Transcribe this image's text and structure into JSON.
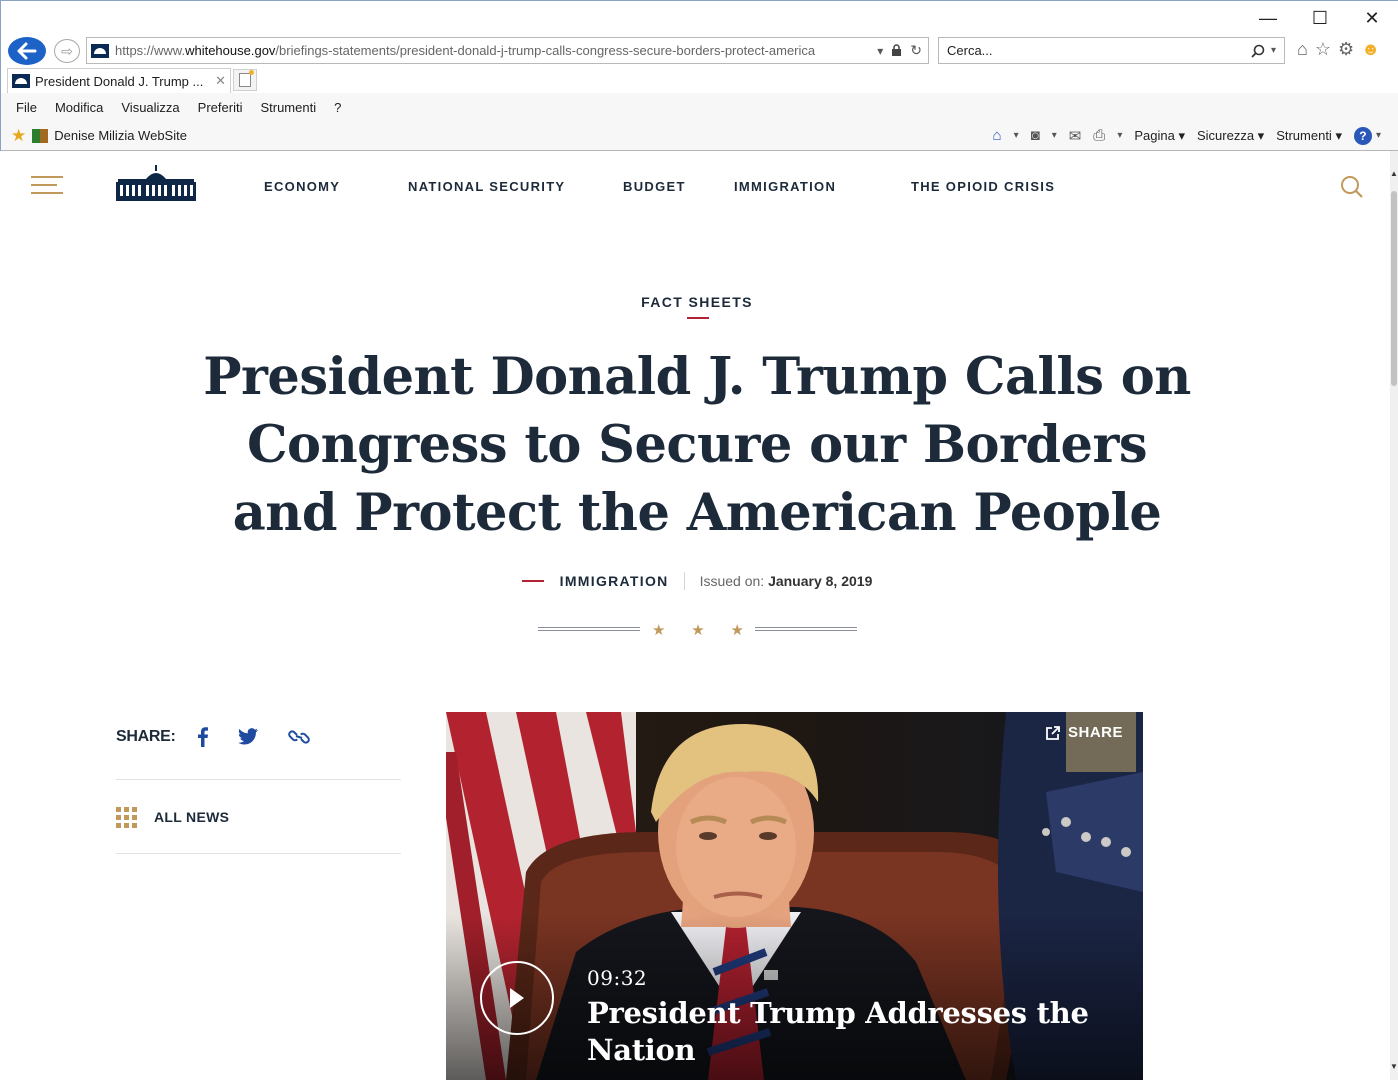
{
  "browser": {
    "caption": {
      "minimize": "—",
      "maximize": "☐",
      "close": "✕"
    },
    "address": {
      "url_prefix": "https://www.",
      "url_domain": "whitehouse.gov",
      "url_path": "/briefings-statements/president-donald-j-trump-calls-congress-secure-borders-protect-america"
    },
    "search": {
      "placeholder": "Cerca..."
    },
    "tab": {
      "title": "President Donald J. Trump ...",
      "close": "✕"
    },
    "menu": [
      "File",
      "Modifica",
      "Visualizza",
      "Preferiti",
      "Strumenti",
      "?"
    ],
    "favorites": {
      "site": "Denise Milizia WebSite"
    },
    "commandbar": {
      "pagina": "Pagina",
      "sicurezza": "Sicurezza",
      "strumenti": "Strumenti"
    }
  },
  "site": {
    "nav": [
      "ECONOMY",
      "NATIONAL SECURITY",
      "BUDGET",
      "IMMIGRATION",
      "THE OPIOID CRISIS"
    ],
    "accent_gold": "#c0995b",
    "accent_red": "#b22234",
    "navy": "#1d2a3a"
  },
  "article": {
    "kicker": "FACT SHEETS",
    "headline": "President Donald J. Trump Calls on Congress to Secure our Borders and Protect the American People",
    "category": "IMMIGRATION",
    "issued_label": "Issued on:",
    "issued_date": "January 8, 2019",
    "stars": [
      "★",
      "★",
      "★"
    ]
  },
  "share": {
    "label": "SHARE:",
    "all_news": "ALL NEWS"
  },
  "video": {
    "share_label": "SHARE",
    "duration": "09:32",
    "title": "President Trump Addresses the Nation"
  }
}
